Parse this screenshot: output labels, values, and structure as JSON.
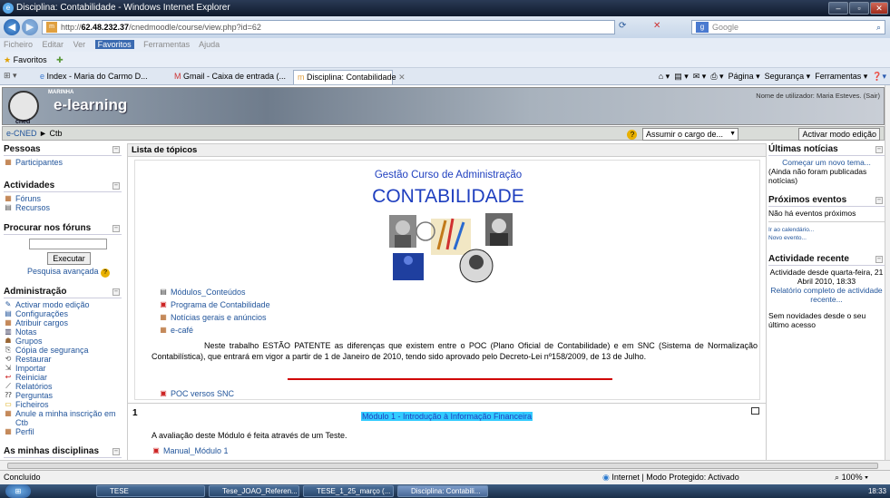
{
  "window": {
    "title": "Disciplina: Contabilidade - Windows Internet Explorer"
  },
  "address": {
    "url_prefix": "http://",
    "url_host": "62.48.232.37",
    "url_path": "/cnedmoodle/course/view.php?id=62",
    "search_placeholder": "Google"
  },
  "menubar": [
    "Ficheiro",
    "Editar",
    "Ver",
    "Favoritos",
    "Ferramentas",
    "Ajuda"
  ],
  "favorites": {
    "label": "Favoritos"
  },
  "tabs": [
    "Index - Maria do Carmo D...",
    "Gmail - Caixa de entrada (...",
    "Disciplina: Contabilidade"
  ],
  "command_bar": {
    "page": "Página",
    "security": "Segurança",
    "tools": "Ferramentas"
  },
  "header": {
    "logo_top": "MARINHA",
    "logo_name": "e-learning",
    "logo_bottom": "cned",
    "user_text": "Nome de utilizador: Maria Esteves. (Sair)"
  },
  "breadcrumb": {
    "home": "e-CNED",
    "sep": "►",
    "current": "Ctb"
  },
  "role": {
    "select_value": "Assumir o cargo de...",
    "edit_button": "Activar modo edição"
  },
  "left": {
    "people_title": "Pessoas",
    "participants": "Participantes",
    "activities_title": "Actividades",
    "forums": "Fóruns",
    "resources": "Recursos",
    "search_title": "Procurar nos fóruns",
    "search_button": "Executar",
    "advanced_search": "Pesquisa avançada",
    "admin_title": "Administração",
    "admin_items": [
      "Activar modo edição",
      "Configurações",
      "Atribuir cargos",
      "Notas",
      "Grupos",
      "Cópia de segurança",
      "Restaurar",
      "Importar",
      "Reiniciar",
      "Relatórios",
      "Perguntas",
      "Ficheiros",
      "Anule a minha inscrição em Ctb",
      "Perfil"
    ],
    "my_courses_title": "As minhas disciplinas"
  },
  "main": {
    "topics_title": "Lista de tópicos",
    "course_subtitle": "Gestão  Curso de Administração",
    "course_title": "CONTABILIDADE",
    "links": [
      "Módulos_Conteúdos",
      "Programa de Contabilidade",
      "Notícias gerais e anúncios",
      "e-café"
    ],
    "paragraph": "Neste trabalho ESTÃO PATENTE as diferenças que existem entre o POC (Plano Oficial de Contabilidade) e em SNC (Sistema de Normalização Contabilística), que entrará em vigor a partir de 1 de Janeiro de 2010, tendo sido aprovado pelo Decreto-Lei nº158/2009, de 13 de Julho.",
    "poc_link": "POC versos SNC",
    "topic1_number": "1",
    "topic1_title": "Módulo 1 - Introdução à Informação Financeira",
    "topic1_text": "A avaliação deste Módulo é feita através de  um  Teste.",
    "topic1_link": "Manual_Módulo 1"
  },
  "right": {
    "news_title": "Últimas notícias",
    "news_new_topic": "Começar um novo tema...",
    "news_empty": "(Ainda não foram publicadas notícias)",
    "events_title": "Próximos eventos",
    "events_empty": "Não há eventos próximos",
    "go_calendar": "Ir ao calendário...",
    "new_event": "Novo evento...",
    "recent_title": "Actividade recente",
    "recent_since": "Actividade desde quarta-feira, 21 Abril 2010, 18:33",
    "recent_report": "Relatório completo de actividade recente...",
    "recent_none": "Sem novidades desde o seu último acesso"
  },
  "status": {
    "left": "Concluído",
    "zone": "Internet | Modo Protegido: Activado",
    "zoom": "100%"
  },
  "taskbar": {
    "items": [
      "TESE",
      "Tese_JOAO_Referen...",
      "TESE_1_25_março (...",
      "Disciplina: Contabili..."
    ],
    "clock": "18:33"
  },
  "colors": {
    "link": "#22559b",
    "title_blue": "#1f3fbf",
    "highlight": "#33ccff",
    "red_line": "#d00000"
  }
}
